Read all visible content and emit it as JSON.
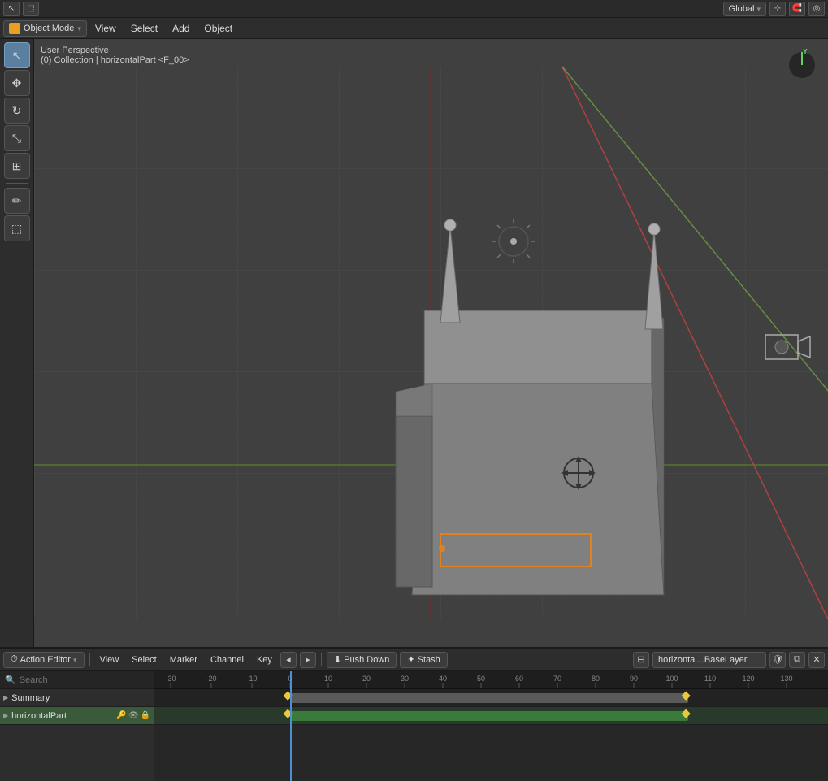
{
  "topToolbar": {
    "icons": [
      "cursor",
      "box-select"
    ],
    "rightItems": {
      "global_label": "Global",
      "transform_icons": [
        "transform-pivot",
        "transform-orientation",
        "snap",
        "proportional"
      ]
    }
  },
  "menuBar": {
    "mode": "Object Mode",
    "items": [
      "View",
      "Select",
      "Add",
      "Object"
    ]
  },
  "viewport": {
    "info_line1": "User Perspective",
    "info_line2": "(0) Collection | horizontalPart <F_00>"
  },
  "leftTools": [
    {
      "name": "select-cursor",
      "icon": "↖",
      "active": true
    },
    {
      "name": "move",
      "icon": "✥",
      "active": false
    },
    {
      "name": "rotate",
      "icon": "↻",
      "active": false
    },
    {
      "name": "scale",
      "icon": "⤡",
      "active": false
    },
    {
      "name": "transform",
      "icon": "⊞",
      "active": false
    },
    {
      "name": "annotate",
      "icon": "✏",
      "active": false
    },
    {
      "name": "measure",
      "icon": "⬚",
      "active": false
    }
  ],
  "bottomPanel": {
    "editorType": "Action Editor",
    "menuItems": [
      "View",
      "Select",
      "Marker",
      "Channel",
      "Key"
    ],
    "pushDown": "Push Down",
    "stash": "Stash",
    "actionName": "horizontal...BaseLayer",
    "channels": [
      {
        "label": "Summary",
        "type": "summary"
      },
      {
        "label": "horizontalPart",
        "type": "channel",
        "selected": true
      }
    ],
    "frameNumbers": [
      "-30",
      "-20",
      "-10",
      "0",
      "10",
      "20",
      "30",
      "40",
      "50",
      "60",
      "70",
      "80",
      "90",
      "100",
      "110",
      "120",
      "130"
    ],
    "currentFrame": "0"
  },
  "axisIndicator": {
    "y_label": "Y",
    "color": "#60d060"
  }
}
